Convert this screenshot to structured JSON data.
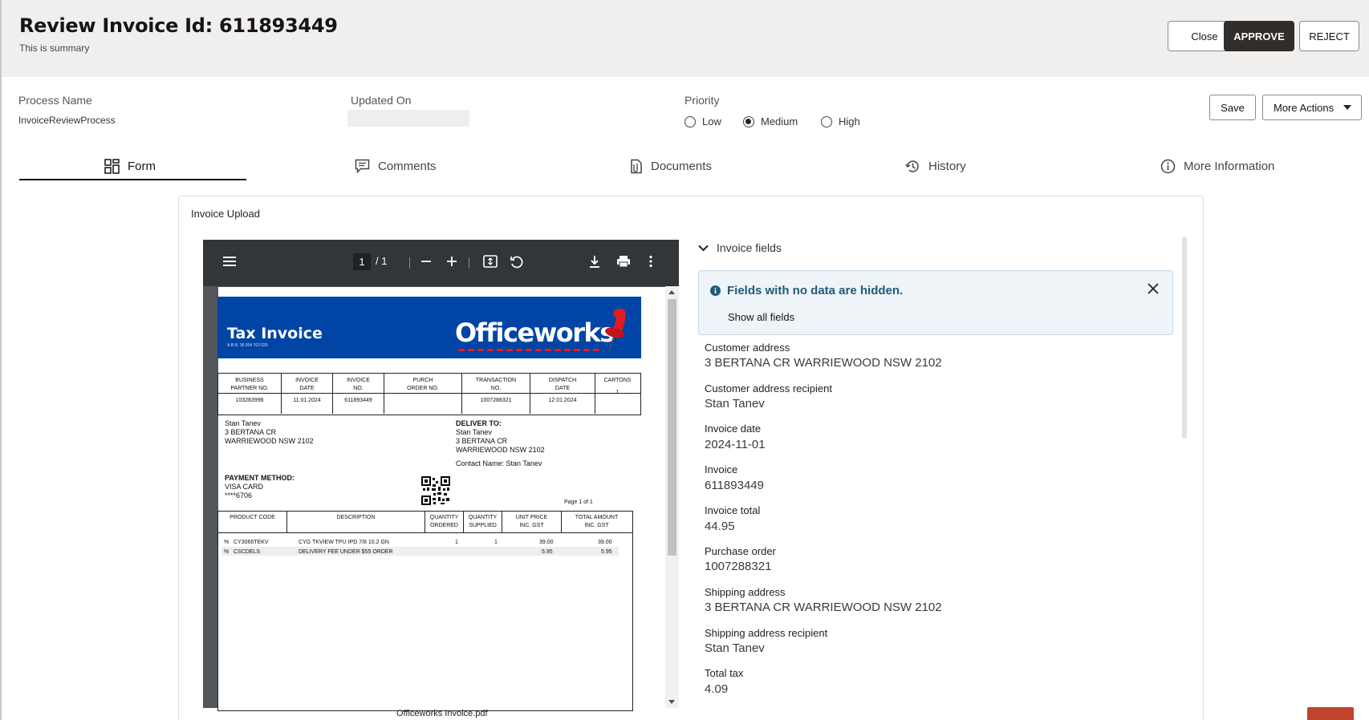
{
  "header": {
    "title": "Review Invoice Id: 611893449",
    "subtitle": "This is summary",
    "close_label": "Close",
    "approve_label": "APPROVE",
    "reject_label": "REJECT"
  },
  "meta": {
    "process_name_label": "Process Name",
    "process_name_value": "InvoiceReviewProcess",
    "updated_on_label": "Updated On",
    "updated_on_value": "",
    "priority_label": "Priority",
    "priority_options": [
      "Low",
      "Medium",
      "High"
    ],
    "priority_selected": "Medium",
    "save_label": "Save",
    "more_actions_label": "More Actions"
  },
  "tabs": [
    {
      "label": "Form",
      "icon": "form-grid-icon",
      "active": true
    },
    {
      "label": "Comments",
      "icon": "comments-icon"
    },
    {
      "label": "Documents",
      "icon": "documents-icon"
    },
    {
      "label": "History",
      "icon": "history-icon"
    },
    {
      "label": "More Information",
      "icon": "info-icon"
    }
  ],
  "card": {
    "title": "Invoice Upload"
  },
  "pdf": {
    "current_page": "1",
    "page_separator": "/ 1",
    "filename": "Officeworks Invoice.pdf",
    "invoice": {
      "heading": "Tax Invoice",
      "abn": "A.B.N. 36 004 763 526",
      "brand": "Officeworks",
      "header_cols": [
        {
          "h1": "BUSINESS",
          "h2": "PARTNER NO.",
          "v": "103283996"
        },
        {
          "h1": "INVOICE",
          "h2": "DATE",
          "v": "11.01.2024"
        },
        {
          "h1": "INVOICE",
          "h2": "NO.",
          "v": "611893449"
        },
        {
          "h1": "PURCH",
          "h2": "ORDER NO.",
          "v": ""
        },
        {
          "h1": "TRANSACTION",
          "h2": "NO.",
          "v": "1007288321"
        },
        {
          "h1": "DISPATCH",
          "h2": "DATE",
          "v": "12.01.2024"
        },
        {
          "h1": "CARTONS",
          "h2": "",
          "v": "1"
        }
      ],
      "bill_to": [
        "Stan Tanev",
        "3 BERTANA CR",
        "WARRIEWOOD NSW 2102"
      ],
      "deliver_to_label": "DELIVER TO:",
      "deliver_to": [
        "Stan Tanev",
        "3 BERTANA CR",
        "WARRIEWOOD NSW 2102"
      ],
      "contact": "Contact Name: Stan Tanev",
      "payment_label": "PAYMENT METHOD:",
      "payment": [
        "VISA CARD",
        "****6706"
      ],
      "page_info": "Page 1   of   1",
      "line_cols": [
        {
          "h1": "PRODUCT CODE",
          "h2": ""
        },
        {
          "h1": "DESCRIPTION",
          "h2": ""
        },
        {
          "h1": "QUANTITY",
          "h2": "ORDERED"
        },
        {
          "h1": "QUANTITY",
          "h2": "SUPPLIED"
        },
        {
          "h1": "UNIT PRICE",
          "h2": "INC. GST"
        },
        {
          "h1": "TOTAL AMOUNT",
          "h2": "INC. GST"
        }
      ],
      "lines": [
        {
          "flag": "%",
          "code": "CY3066TEKV",
          "desc": "CYG TKVIEW TPU IPD 7/8 10.2 GN",
          "ordered": "1",
          "supplied": "1",
          "unit": "39.00",
          "total": "39.00"
        },
        {
          "flag": "%",
          "code": "CSCDELS",
          "desc": "DELIVERY FEE UNDER $55 ORDER",
          "ordered": "",
          "supplied": "",
          "unit": "5.95",
          "total": "5.95"
        }
      ]
    }
  },
  "fields_panel": {
    "header": "Invoice fields",
    "notice": "Fields with no data are hidden.",
    "show_all": "Show all fields",
    "fields": [
      {
        "label": "Customer address",
        "value": "3 BERTANA CR WARRIEWOOD NSW 2102"
      },
      {
        "label": "Customer address recipient",
        "value": "Stan Tanev"
      },
      {
        "label": "Invoice date",
        "value": "2024-11-01"
      },
      {
        "label": "Invoice",
        "value": "611893449"
      },
      {
        "label": "Invoice total",
        "value": "44.95"
      },
      {
        "label": "Purchase order",
        "value": "1007288321"
      },
      {
        "label": "Shipping address",
        "value": "3 BERTANA CR WARRIEWOOD NSW 2102"
      },
      {
        "label": "Shipping address recipient",
        "value": "Stan Tanev"
      },
      {
        "label": "Total tax",
        "value": "4.09"
      }
    ]
  },
  "colors": {
    "approve_bg": "#312d2a",
    "brand_blue": "#0045a5",
    "notice_text": "#205b7a",
    "accent_red": "#c0432e"
  }
}
